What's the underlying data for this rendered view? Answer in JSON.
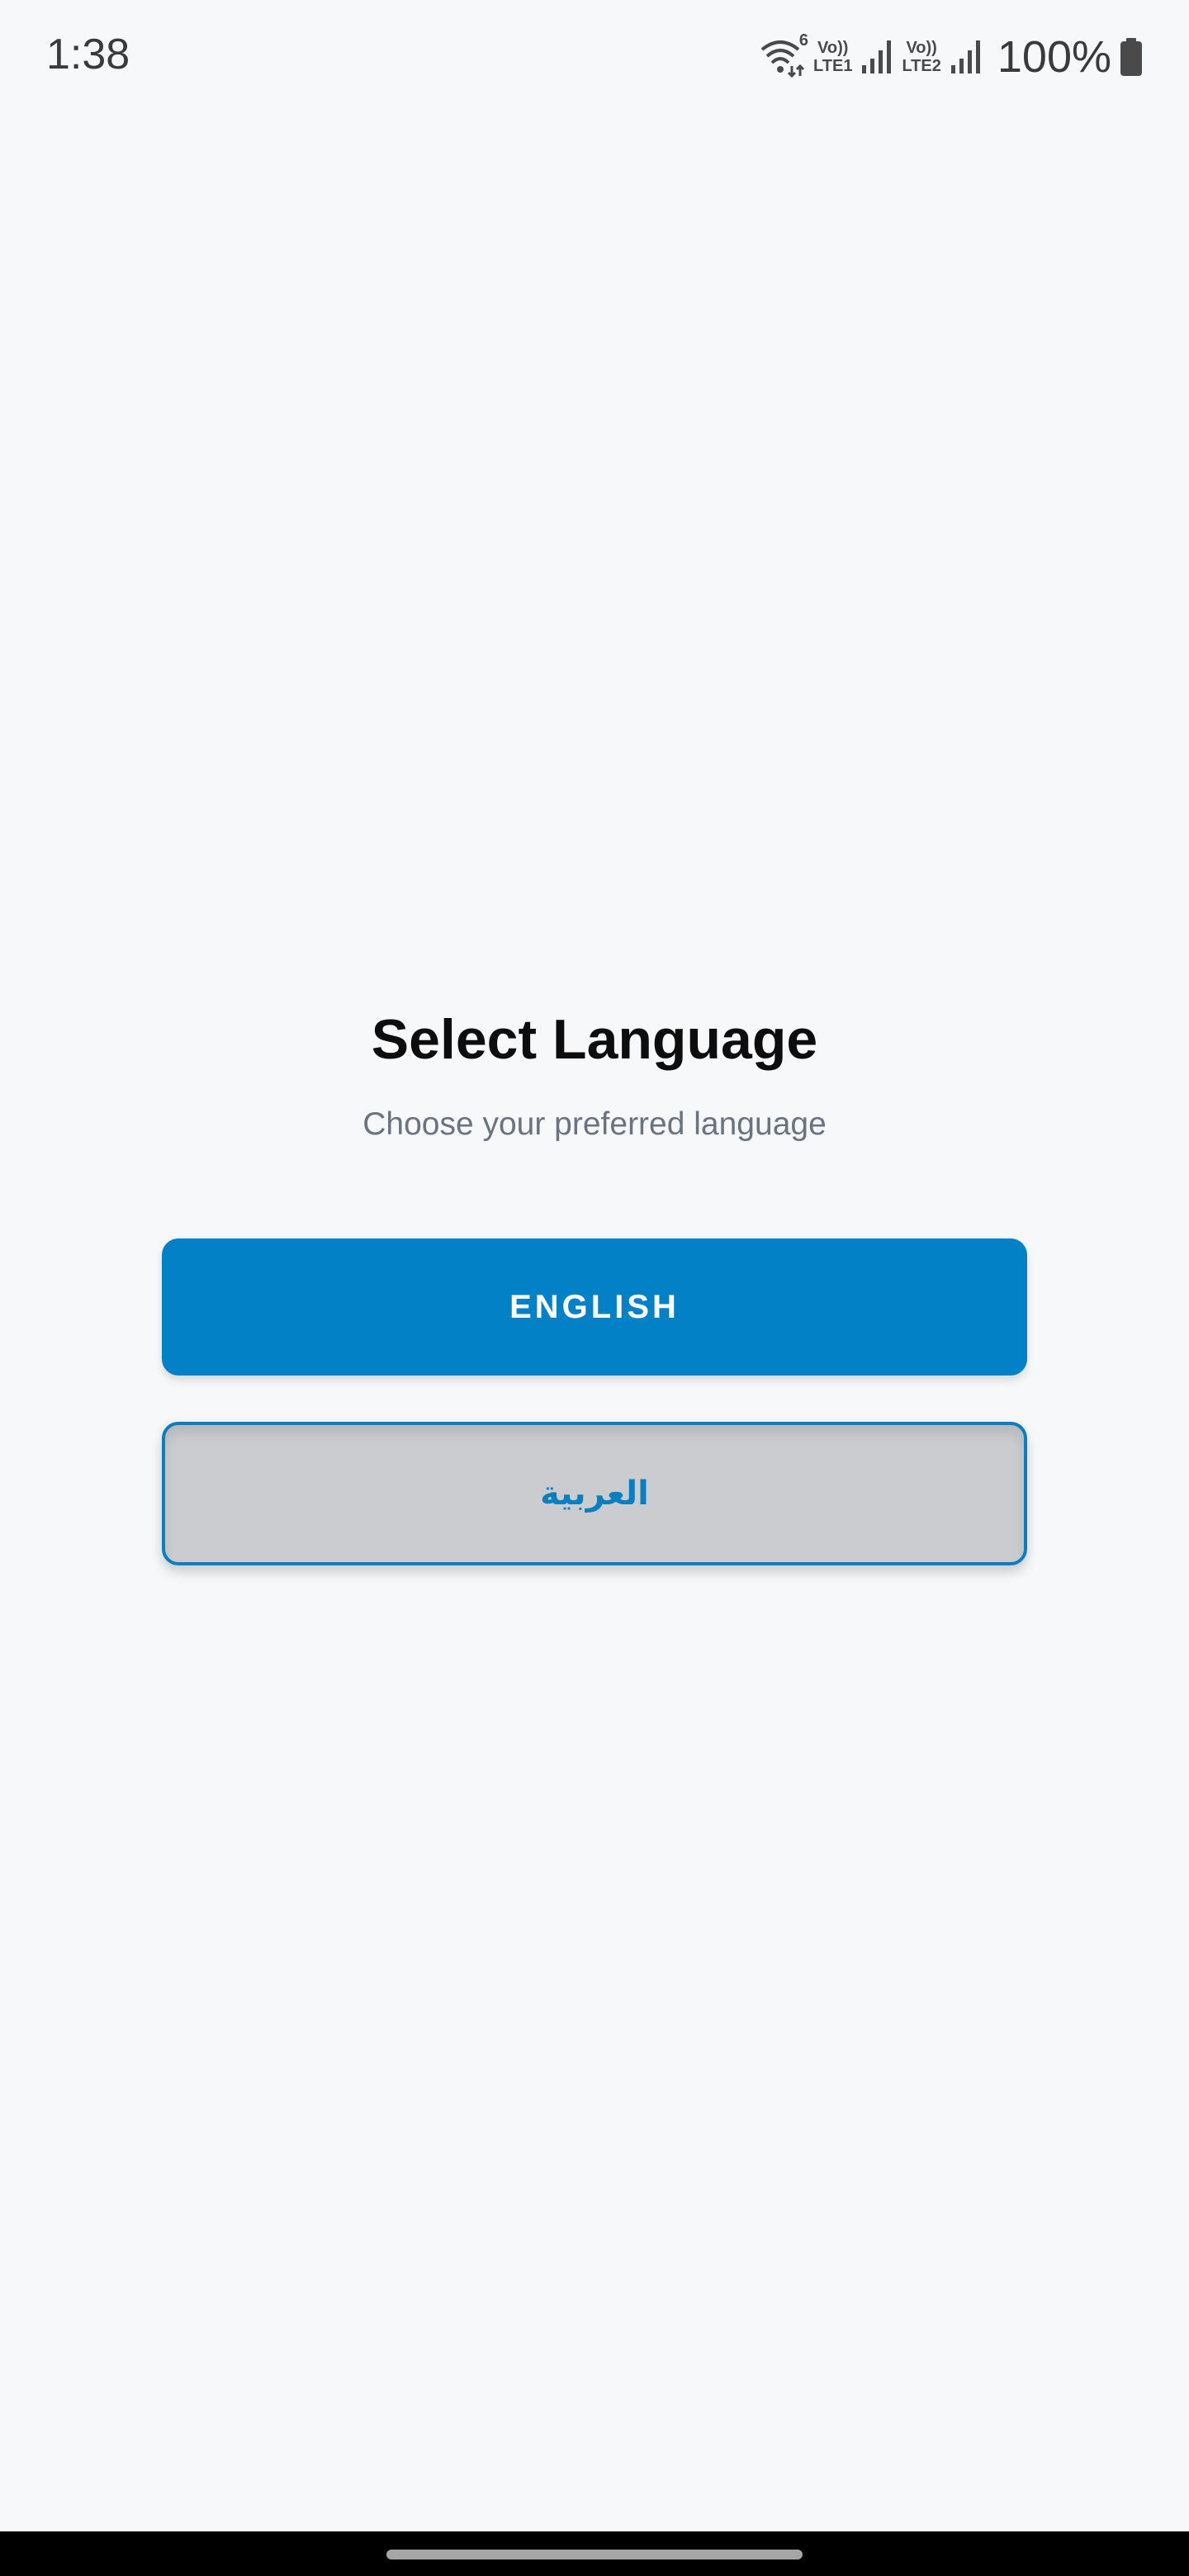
{
  "status_bar": {
    "time": "1:38",
    "wifi_label": "6",
    "sim1_top": "Vo))",
    "sim1_bottom": "LTE1",
    "sim2_top": "Vo))",
    "sim2_bottom": "LTE2",
    "battery": "100%",
    "icons": [
      "wifi-icon",
      "signal-icon",
      "signal-icon",
      "battery-icon"
    ]
  },
  "screen": {
    "title": "Select Language",
    "subtitle": "Choose your preferred language",
    "buttons": {
      "english": "ENGLISH",
      "arabic": "العربية"
    }
  },
  "colors": {
    "background": "#f7f8fa",
    "primary": "#0281c7",
    "secondary_bg": "#cbcccf",
    "subtitle": "#6b7280"
  }
}
